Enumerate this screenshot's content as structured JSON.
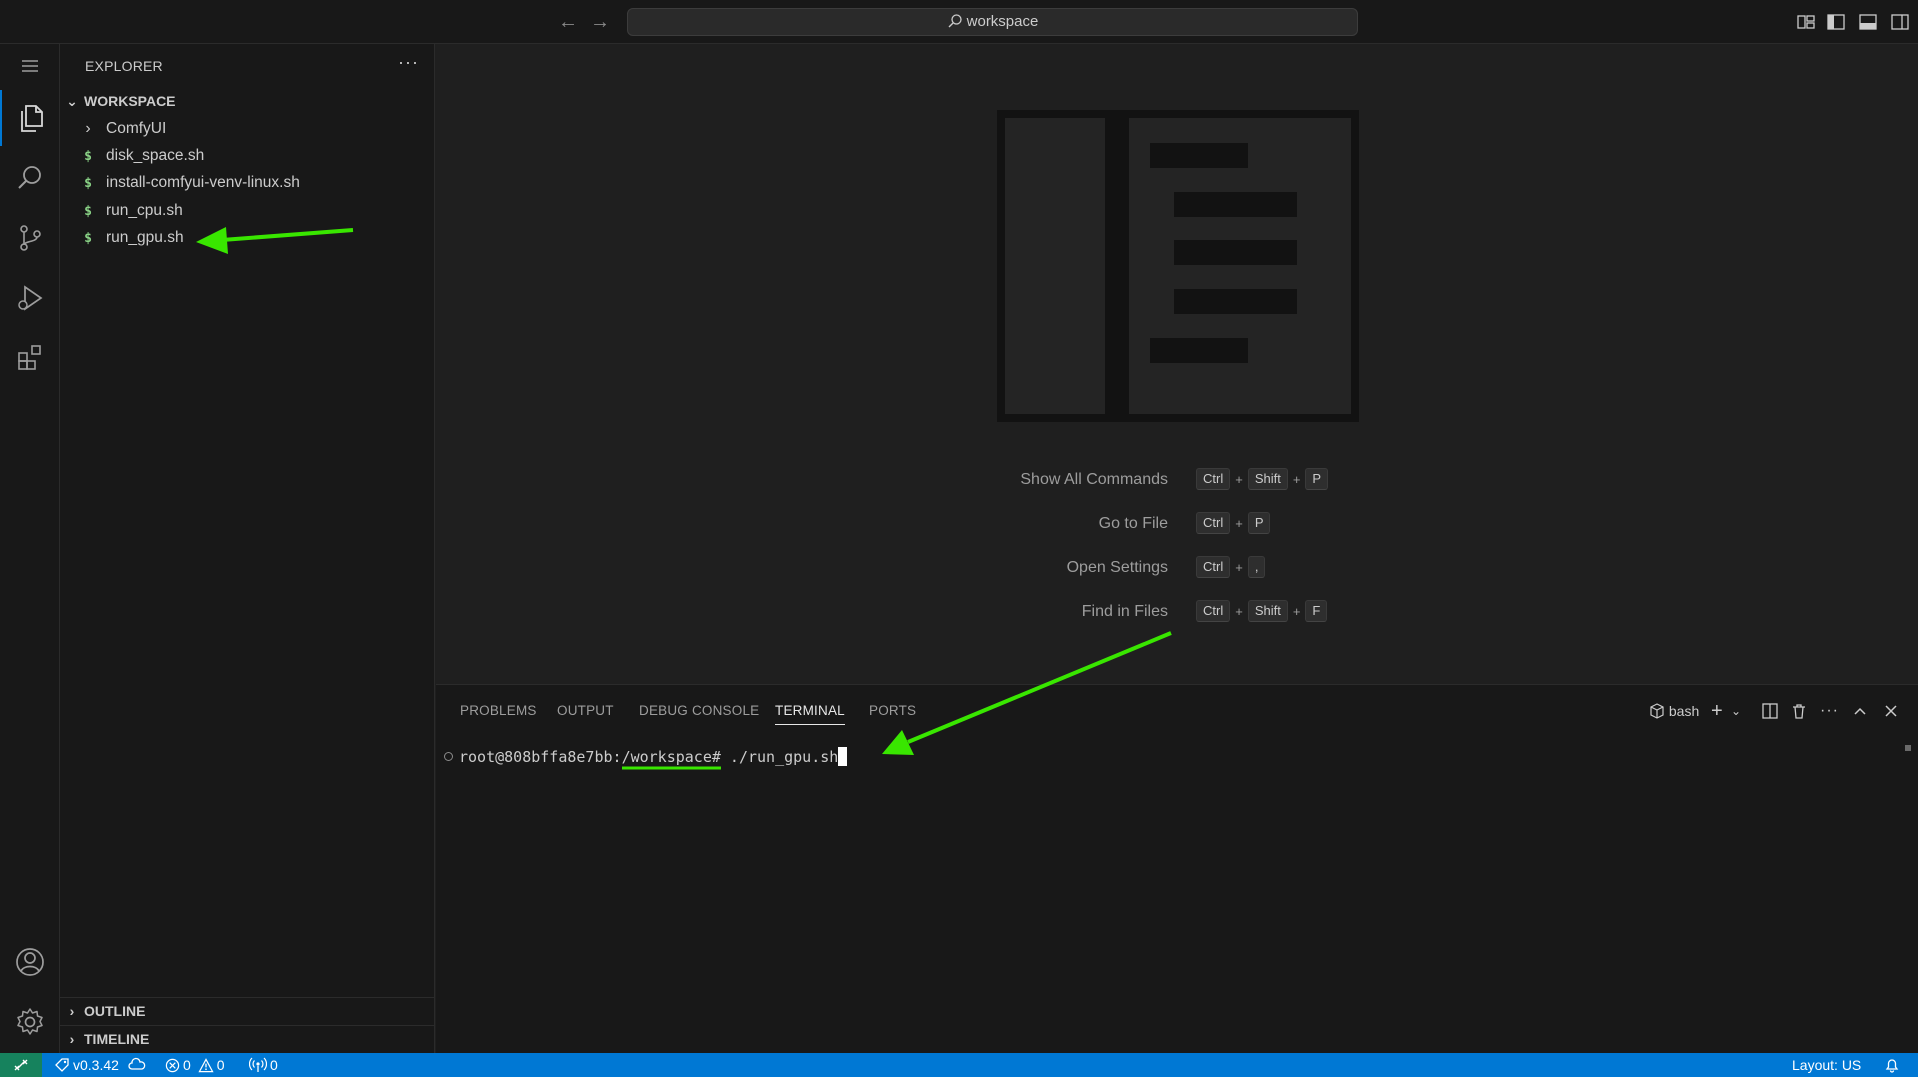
{
  "titlebar": {
    "back_icon": "arrow-left-icon",
    "forward_icon": "arrow-right-icon",
    "search_text": "workspace",
    "layout_icons": [
      "customize-layout-icon",
      "toggle-primary-sidebar-icon",
      "toggle-panel-icon",
      "toggle-secondary-sidebar-icon"
    ]
  },
  "activitybar": {
    "items": [
      "menu-icon",
      "explorer-icon",
      "search-icon",
      "source-control-icon",
      "run-debug-icon",
      "extensions-icon"
    ],
    "bottom": [
      "accounts-icon",
      "manage-gear-icon"
    ],
    "accent": "#0078d4"
  },
  "sidebar": {
    "title": "EXPLORER",
    "more": "···",
    "workspace_header": "WORKSPACE",
    "tree": [
      {
        "type": "folder",
        "label": "ComfyUI"
      },
      {
        "type": "file",
        "icon": "$",
        "label": "disk_space.sh"
      },
      {
        "type": "file",
        "icon": "$",
        "label": "install-comfyui-venv-linux.sh"
      },
      {
        "type": "file",
        "icon": "$",
        "label": "run_cpu.sh"
      },
      {
        "type": "file",
        "icon": "$",
        "label": "run_gpu.sh"
      }
    ],
    "outline_header": "OUTLINE",
    "timeline_header": "TIMELINE"
  },
  "editor": {
    "hints": [
      {
        "label": "Show All Commands",
        "keys": [
          "Ctrl",
          "Shift",
          "P"
        ]
      },
      {
        "label": "Go to File",
        "keys": [
          "Ctrl",
          "P"
        ]
      },
      {
        "label": "Open Settings",
        "keys": [
          "Ctrl",
          ","
        ]
      },
      {
        "label": "Find in Files",
        "keys": [
          "Ctrl",
          "Shift",
          "F"
        ]
      }
    ]
  },
  "panel": {
    "tabs": [
      "PROBLEMS",
      "OUTPUT",
      "DEBUG CONSOLE",
      "TERMINAL",
      "PORTS"
    ],
    "active_tab": "TERMINAL",
    "shell_label": "bash",
    "terminal": {
      "prompt_user": "root@808bffa8e7bb:",
      "prompt_path": "/workspace#",
      "command": " ./run_gpu.sh"
    }
  },
  "statusbar": {
    "version": "v0.3.42",
    "errors": "0",
    "warnings": "0",
    "ports": "0",
    "layout": "Layout: US",
    "bg_color": "#0078d4",
    "remote_color": "#16825d"
  },
  "annotations": {
    "arrow_color": "#39e600"
  }
}
